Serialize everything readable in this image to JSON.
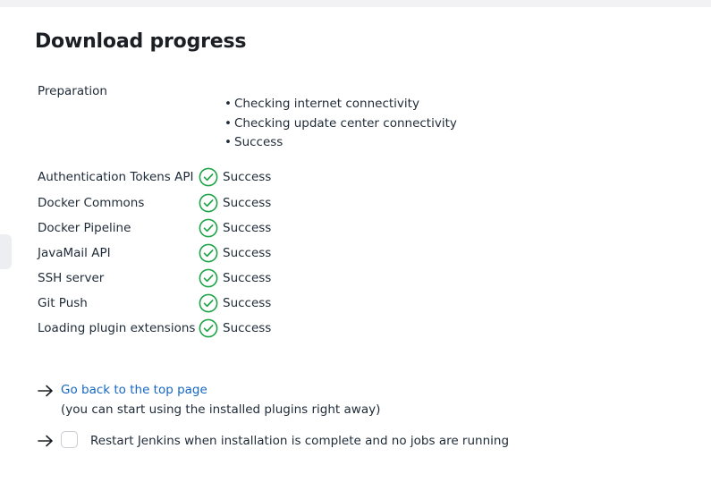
{
  "page": {
    "title": "Download progress"
  },
  "preparation": {
    "label": "Preparation",
    "steps": [
      "Checking internet connectivity",
      "Checking update center connectivity",
      "Success"
    ]
  },
  "plugins": [
    {
      "name": "Authentication Tokens API",
      "status": "Success"
    },
    {
      "name": "Docker Commons",
      "status": "Success"
    },
    {
      "name": "Docker Pipeline",
      "status": "Success"
    },
    {
      "name": "JavaMail API",
      "status": "Success"
    },
    {
      "name": "SSH server",
      "status": "Success"
    },
    {
      "name": "Git Push",
      "status": "Success"
    },
    {
      "name": "Loading plugin extensions",
      "status": "Success"
    }
  ],
  "footer": {
    "back_link": "Go back to the top page",
    "back_note": "(you can start using the installed plugins right away)",
    "restart_label": "Restart Jenkins when installation is complete and no jobs are running",
    "restart_checked": false
  },
  "icons": {
    "status": "check-circle-icon",
    "arrow": "arrow-right-icon"
  },
  "colors": {
    "success": "#1ea446",
    "link": "#1667c2",
    "text": "#1e2a37"
  }
}
